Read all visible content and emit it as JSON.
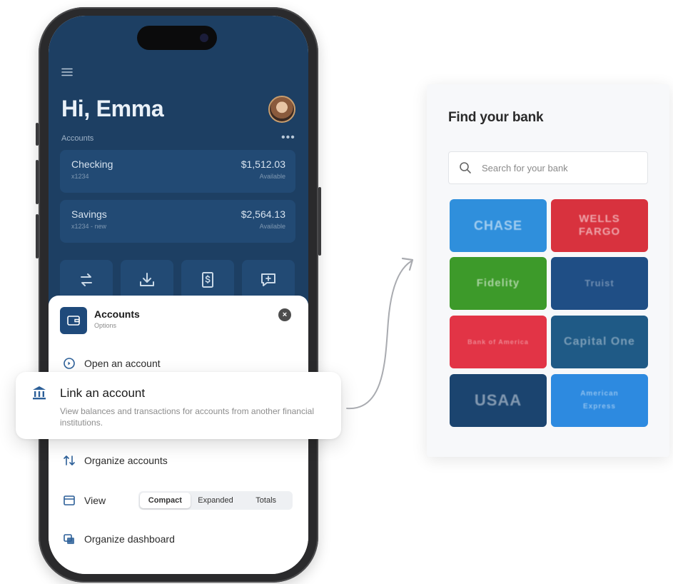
{
  "colors": {
    "navy": "#1d3f63",
    "card": "#224a74",
    "accent": "#2c5f98",
    "bank_panel_bg": "#f7f8fa"
  },
  "phone": {
    "greeting": "Hi, Emma",
    "section_label": "Accounts",
    "menu_icon": "hamburger-menu-icon",
    "more_icon": "more-horizontal-icon",
    "accounts": [
      {
        "name": "Checking",
        "number": "x1234",
        "amount": "$1,512.03",
        "status": "Available"
      },
      {
        "name": "Savings",
        "number": "x1234 - new",
        "amount": "$2,564.13",
        "status": "Available"
      }
    ],
    "actions": [
      {
        "icon": "transfer-icon"
      },
      {
        "icon": "deposit-icon"
      },
      {
        "icon": "pay-bill-icon"
      },
      {
        "icon": "message-icon"
      }
    ]
  },
  "sheet": {
    "title": "Accounts",
    "subtitle": "Options",
    "close_icon": "close-icon",
    "items": {
      "open": "Open an account",
      "organize": "Organize accounts",
      "view": "View",
      "dashboard": "Organize dashboard"
    },
    "view_options": [
      "Compact",
      "Expanded",
      "Totals"
    ],
    "view_selected": "Compact"
  },
  "link_card": {
    "title": "Link an account",
    "description": "View balances and transactions for accounts from another financial institutions.",
    "icon": "bank-icon"
  },
  "bank_panel": {
    "title": "Find your bank",
    "search_placeholder": "Search for your bank",
    "banks": [
      {
        "name": "CHASE",
        "color": "#2f8fdc"
      },
      {
        "name": "WELLS FARGO",
        "color": "#d8323e"
      },
      {
        "name": "Fidelity",
        "color": "#3d9a2a"
      },
      {
        "name": "Truist",
        "color": "#1f4e85"
      },
      {
        "name": "Bank of America",
        "color": "#e23446"
      },
      {
        "name": "Capital One",
        "color": "#1f5a86"
      },
      {
        "name": "USAA",
        "color": "#1b446f"
      },
      {
        "name": "American Express",
        "color": "#2d8ae0"
      }
    ]
  }
}
